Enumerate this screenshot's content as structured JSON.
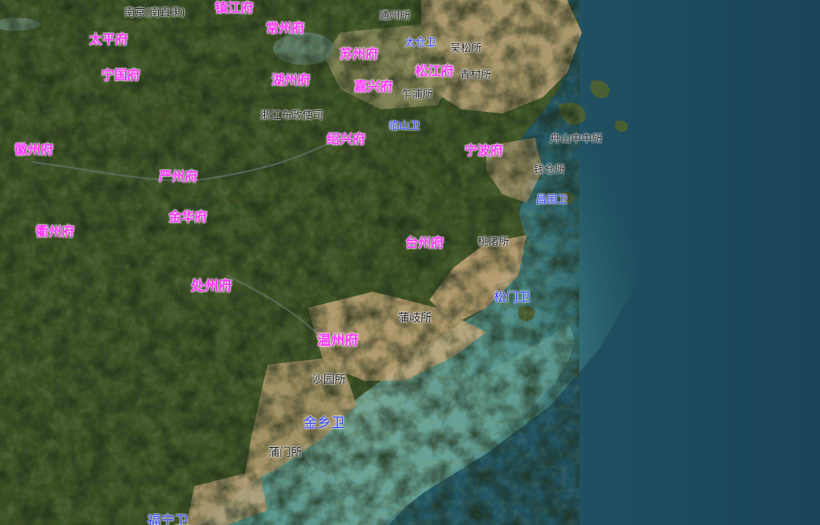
{
  "colors": {
    "prefecture": "#ff33ff",
    "garrison": "#2a3cff",
    "post": "#1a1a1a",
    "land_dark": "#3d5128",
    "land_light": "#6f7a4a",
    "plain": "#a7936a",
    "mudflat": "#c9a57d",
    "shallow": "#5c9f98",
    "sea": "#1f4a5e"
  },
  "labels": {
    "nanjing": "南京(南直隶)",
    "zhenjiang": "镇江府",
    "tongzhou": "通州所",
    "taiping": "太平府",
    "changzhou": "常州府",
    "taicang": "太仓卫",
    "wusong": "吴松所",
    "suzhou": "苏州府",
    "ningguo": "宁国府",
    "huzhou": "湖州府",
    "songjiang": "松江府",
    "qingcun": "青村所",
    "jiaxing": "嘉兴府",
    "zhapu": "乍浦所",
    "zhejiang": "浙江布政使司",
    "linshan": "临山卫",
    "shaoxing": "绍兴府",
    "zhoushan": "舟山中中所",
    "huizhou": "徽州府",
    "ningbo": "宁波府",
    "qiancang": "钱仓所",
    "yanzhou": "严州府",
    "changguo": "昌国卫",
    "jinhua": "金华府",
    "quzhou": "衢州府",
    "taizhou": "台州府",
    "taozhu": "桃渚所",
    "chuzhou": "处州府",
    "songmen": "松门卫",
    "puqi": "蒲岐所",
    "wenzhou": "温州府",
    "shayuan": "沙园所",
    "jinxiang": "金乡卫",
    "pumen": "蒲门所",
    "funing": "福宁卫"
  }
}
